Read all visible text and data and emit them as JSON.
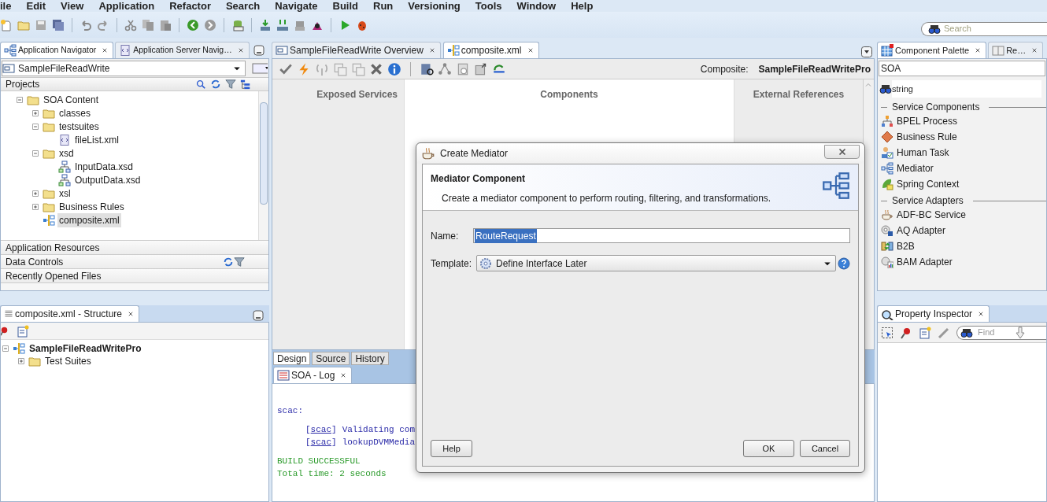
{
  "menu": [
    "ile",
    "Edit",
    "View",
    "Application",
    "Refactor",
    "Search",
    "Navigate",
    "Build",
    "Run",
    "Versioning",
    "Tools",
    "Window",
    "Help"
  ],
  "search": {
    "placeholder": "Search"
  },
  "navigator": {
    "tabs": [
      {
        "label": "Application Navigator",
        "selected": true
      },
      {
        "label": "Application Server Navig…",
        "selected": false
      }
    ],
    "application": "SampleFileReadWrite",
    "projects_header": "Projects",
    "tree": [
      {
        "label": "SOA Content",
        "kind": "folder",
        "expanded": true,
        "selected": false,
        "children": [
          {
            "label": "classes",
            "kind": "folder",
            "expanded": false,
            "selected": false
          },
          {
            "label": "testsuites",
            "kind": "folder",
            "expanded": true,
            "selected": false,
            "children": [
              {
                "label": "fileList.xml",
                "kind": "xml",
                "selected": false
              }
            ]
          },
          {
            "label": "xsd",
            "kind": "folder",
            "expanded": true,
            "selected": false,
            "children": [
              {
                "label": "InputData.xsd",
                "kind": "schema",
                "selected": false
              },
              {
                "label": "OutputData.xsd",
                "kind": "schema",
                "selected": false
              }
            ]
          },
          {
            "label": "xsl",
            "kind": "folder",
            "expanded": false,
            "selected": false
          },
          {
            "label": "Business Rules",
            "kind": "folder",
            "expanded": false,
            "selected": false
          },
          {
            "label": "composite.xml",
            "kind": "composite",
            "selected": true
          }
        ]
      }
    ],
    "sections": [
      "Application Resources",
      "Data Controls",
      "Recently Opened Files"
    ]
  },
  "structure": {
    "tab": "composite.xml - Structure",
    "tree": [
      {
        "label": "SampleFileReadWritePro",
        "kind": "composite",
        "expanded": true,
        "children": [
          {
            "label": "Test Suites",
            "kind": "folder",
            "expanded": false
          }
        ]
      }
    ]
  },
  "editor": {
    "tabs": [
      {
        "label": "SampleFileReadWrite Overview",
        "selected": false
      },
      {
        "label": "composite.xml",
        "selected": true
      }
    ],
    "composite_label": "Composite:",
    "composite_name": "SampleFileReadWritePro",
    "columns": [
      "Exposed Services",
      "Components",
      "External References"
    ],
    "view_tabs": [
      {
        "label": "Design",
        "selected": true
      },
      {
        "label": "Source",
        "selected": false
      },
      {
        "label": "History",
        "selected": false
      }
    ]
  },
  "log": {
    "tab": "SOA - Log",
    "lines": [
      {
        "kind": "plain",
        "text": "scac:"
      },
      {
        "kind": "task",
        "open": "[",
        "task": "scac",
        "close": "]",
        "text": "Validating com"
      },
      {
        "kind": "task",
        "open": "[",
        "task": "scac",
        "close": "]",
        "text": "lookupDVMMedia"
      },
      {
        "kind": "success",
        "text": "BUILD SUCCESSFUL"
      },
      {
        "kind": "success",
        "text": "Total time: 2 seconds"
      }
    ]
  },
  "palette": {
    "tabs": [
      {
        "label": "Component Palette",
        "selected": true
      },
      {
        "label": "Re…",
        "selected": false
      }
    ],
    "category": "SOA",
    "search": "string",
    "groups": [
      {
        "title": "Service Components",
        "items": [
          {
            "label": "BPEL Process",
            "kind": "process"
          },
          {
            "label": "Business Rule",
            "kind": "rule"
          },
          {
            "label": "Human Task",
            "kind": "task"
          },
          {
            "label": "Mediator",
            "kind": "mediator"
          },
          {
            "label": "Spring Context",
            "kind": "spring"
          }
        ]
      },
      {
        "title": "Service Adapters",
        "items": [
          {
            "label": "ADF-BC Service",
            "kind": "service"
          },
          {
            "label": "AQ Adapter",
            "kind": "adapter"
          },
          {
            "label": "B2B",
            "kind": "b2b"
          },
          {
            "label": "BAM Adapter",
            "kind": "bam"
          }
        ]
      }
    ]
  },
  "inspector": {
    "tab": "Property Inspector",
    "find_placeholder": "Find"
  },
  "dialog": {
    "title": "Create Mediator",
    "heading": "Mediator Component",
    "description": "Create a mediator component to perform routing, filtering, and transformations.",
    "name_label": "Name:",
    "name_value": "RouteRequest",
    "template_label": "Template:",
    "template_value": "Define Interface Later",
    "help": "Help",
    "ok": "OK",
    "cancel": "Cancel"
  }
}
